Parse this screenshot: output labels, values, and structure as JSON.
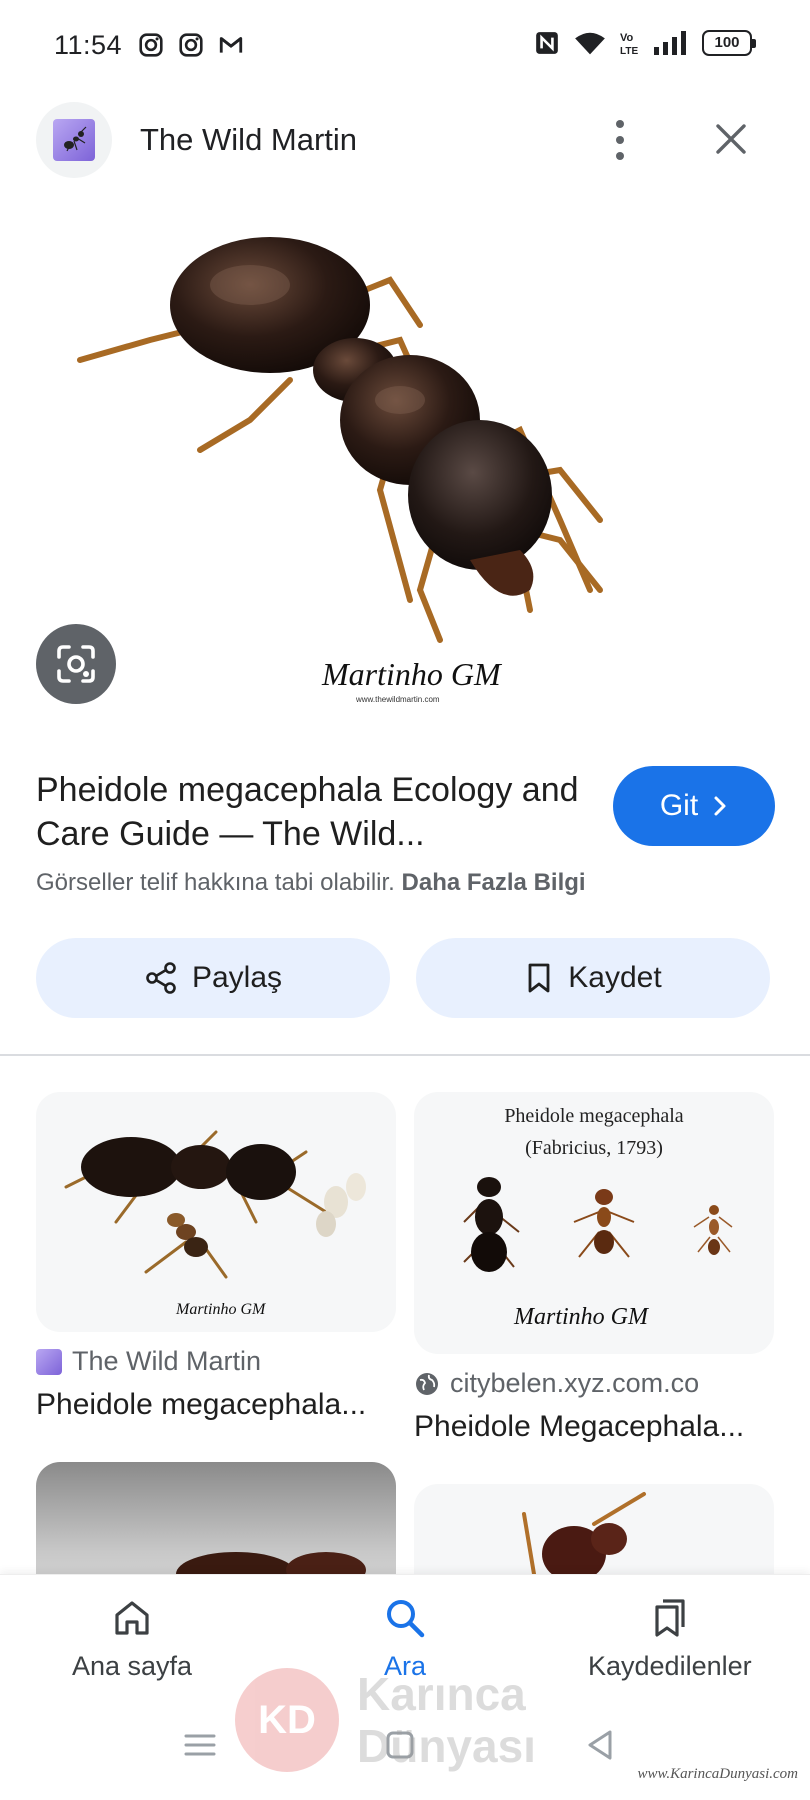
{
  "status_bar": {
    "time": "11:54",
    "battery": "100",
    "network_label": "Vo LTE",
    "app_icons": [
      "instagram-icon",
      "instagram-icon",
      "gmail-icon"
    ],
    "system_icons": [
      "nfc-icon",
      "wifi-icon",
      "volte-icon",
      "signal-icon",
      "battery-icon"
    ]
  },
  "header": {
    "site_name": "The Wild Martin"
  },
  "hero": {
    "signature": "Martinho GM",
    "signature_url": "www.thewildmartin.com"
  },
  "result": {
    "title": "Pheidole megacephala Ecology and Care Guide — The Wild...",
    "go_label": "Git",
    "copyright_text": "Görseller telif hakkına tabi olabilir.",
    "more_info_label": "Daha Fazla Bilgi"
  },
  "actions": {
    "share_label": "Paylaş",
    "save_label": "Kaydet"
  },
  "grid": [
    {
      "source": "The Wild Martin",
      "caption": "Pheidole megacephala...",
      "thumb_signature": "Martinho GM"
    },
    {
      "source": "citybelen.xyz.com.co",
      "caption": "Pheidole Megacephala...",
      "thumb_title_line1": "Pheidole megacephala",
      "thumb_title_line2": "(Fabricius, 1793)",
      "thumb_signature": "Martinho GM"
    }
  ],
  "bottom_nav": {
    "home_label": "Ana sayfa",
    "search_label": "Ara",
    "saved_label": "Kaydedilenler"
  },
  "watermark": {
    "logo": "KD",
    "line1": "Karınca",
    "line2": "Dünyası",
    "url": "www.KarincaDunyasi.com"
  },
  "colors": {
    "accent": "#1a73e8",
    "tonal_button": "#e8f0fe",
    "text_primary": "#1f1f1f",
    "text_secondary": "#5f6368"
  }
}
